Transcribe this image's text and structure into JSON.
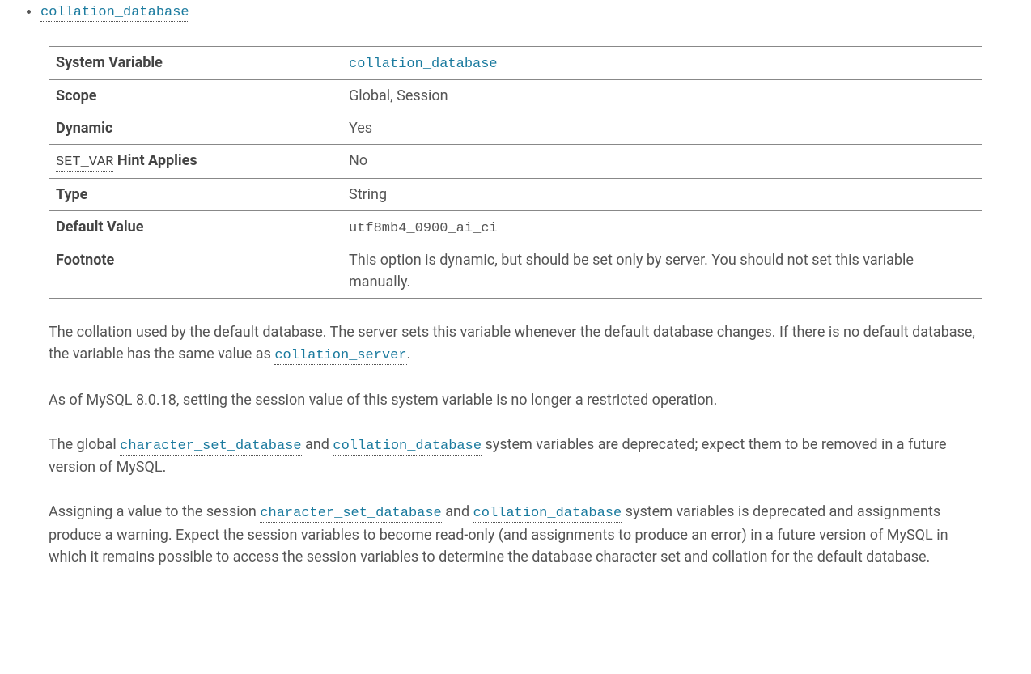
{
  "bullet": {
    "label": "collation_database"
  },
  "table": {
    "rows": [
      {
        "label": "System Variable",
        "value": "collation_database",
        "link": true,
        "mono": true
      },
      {
        "label": "Scope",
        "value": "Global, Session"
      },
      {
        "label": "Dynamic",
        "value": "Yes"
      },
      {
        "label_pre": "SET_VAR",
        "label_post": " Hint Applies",
        "value": "No"
      },
      {
        "label": "Type",
        "value": "String"
      },
      {
        "label": "Default Value",
        "value": "utf8mb4_0900_ai_ci",
        "mono": true
      },
      {
        "label": "Footnote",
        "value": "This option is dynamic, but should be set only by server. You should not set this variable manually."
      }
    ]
  },
  "para1": {
    "t1": "The collation used by the default database. The server sets this variable whenever the default database changes. If there is no default database, the variable has the same value as ",
    "code1": "collation_server",
    "t2": "."
  },
  "para2": "As of MySQL 8.0.18, setting the session value of this system variable is no longer a restricted operation.",
  "para3": {
    "t1": "The global ",
    "code1": "character_set_database",
    "t2": " and ",
    "code2": "collation_database",
    "t3": " system variables are deprecated; expect them to be removed in a future version of MySQL."
  },
  "para4": {
    "t1": "Assigning a value to the session ",
    "code1": "character_set_database",
    "t2": " and ",
    "code2": "collation_database",
    "t3": " system variables is deprecated and assignments produce a warning. Expect the session variables to become read-only (and assignments to produce an error) in a future version of MySQL in which it remains possible to access the session variables to determine the database character set and collation for the default database."
  }
}
